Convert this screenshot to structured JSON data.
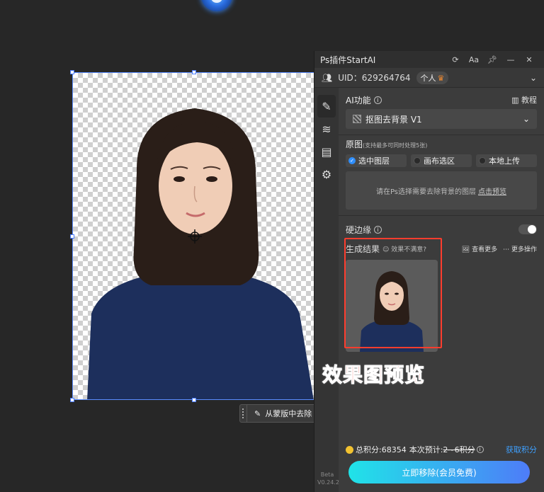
{
  "panel": {
    "title": "Ps插件StartAI",
    "icons": [
      "refresh-icon",
      "font-size-icon",
      "pin-icon",
      "minimize-icon",
      "close-icon"
    ],
    "font_label": "Aa",
    "uid_label": "UID：629264764",
    "account_badge": "个人",
    "ai_function_label": "AI功能",
    "tutorial_label": "教程",
    "selected_function": "抠图去背景 V1",
    "source_label": "原图",
    "source_hint": "(支持最多可同时处理5张)",
    "source_options": [
      {
        "label": "选中图层",
        "selected": true
      },
      {
        "label": "画布选区",
        "selected": false
      },
      {
        "label": "本地上传",
        "selected": false
      }
    ],
    "hint_text": "请在Ps选择需要去除背景的图层",
    "hint_link": "点击预览",
    "hard_edge_label": "硬边缘",
    "hard_edge_on": false,
    "result_label": "生成结果",
    "result_sub": "效果不满意?",
    "view_more": "查看更多",
    "more_actions": "更多操作",
    "total_points": "总积分:68354",
    "estimate_label": "本次预计:",
    "estimate_value": "2~6积分",
    "get_points": "获取积分",
    "cta_label": "立即移除(会员免费)",
    "version_beta": "Beta",
    "version": "V0.24.2"
  },
  "canvas": {
    "mask_button": "从蒙版中去除"
  },
  "annotation": {
    "caption": "效果图预览",
    "color": "#ff3b30"
  },
  "colors": {
    "accent": "#2f8fff",
    "cta_start": "#20e3e8",
    "cta_end": "#4e7cf8",
    "points_link": "#3ea0ff"
  }
}
